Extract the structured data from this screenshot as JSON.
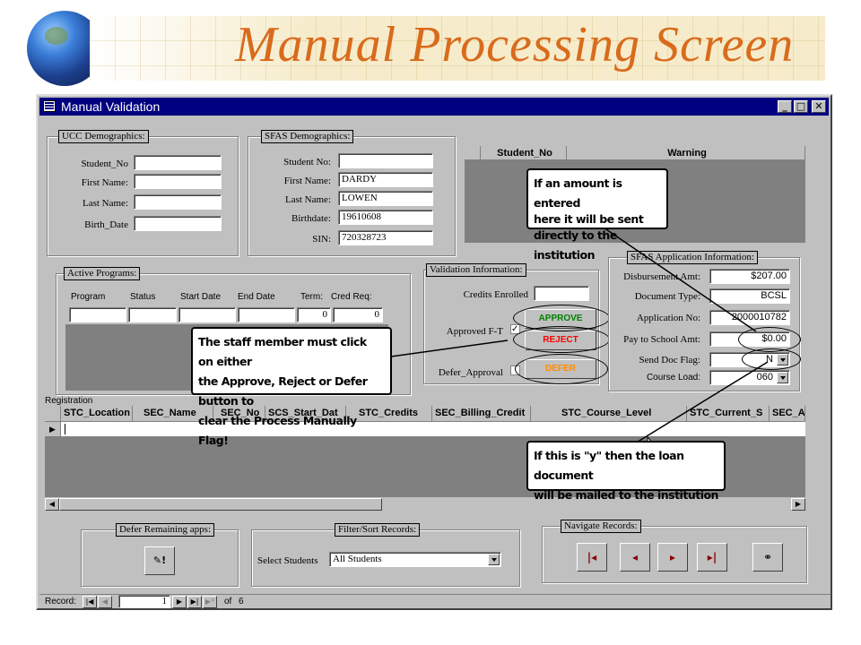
{
  "slide": {
    "title": "Manual Processing Screen"
  },
  "window": {
    "title": "Manual Validation",
    "min": "_",
    "max": "□",
    "close": "✕"
  },
  "ucc": {
    "label": "UCC Demographics:",
    "student_no_label": "Student_No",
    "student_no": "",
    "first_name_label": "First  Name:",
    "first_name": "",
    "last_name_label": "Last  Name:",
    "last_name": "",
    "birth_date_label": "Birth_Date",
    "birth_date": ""
  },
  "sfas": {
    "label": "SFAS Demographics:",
    "student_no_label": "Student  No:",
    "student_no": "",
    "first_name_label": "First  Name:",
    "first_name": "DARDY",
    "last_name_label": "Last  Name:",
    "last_name": "LOWEN",
    "birthdate_label": "Birthdate:",
    "birthdate": "19610608",
    "sin_label": "SIN:",
    "sin": "720328723"
  },
  "warning_grid": {
    "col_student": "Student_No",
    "col_warning": "Warning"
  },
  "active_programs": {
    "label": "Active Programs:",
    "headers": [
      "Program",
      "Status",
      "Start Date",
      "End Date",
      "Term:",
      "Cred Req:"
    ],
    "term": "0",
    "cred_req": "0"
  },
  "validation": {
    "label": "Validation Information:",
    "credits_label": "Credits Enrolled",
    "credits": "",
    "approved_label": "Approved F-T",
    "defer_label": "Defer_Approval",
    "approve_btn": "APPROVE",
    "reject_btn": "REJECT",
    "defer_btn": "DEFER"
  },
  "sfas_app": {
    "label": "SFAS Application Information:",
    "disb_label": "Disbursement Amt:",
    "disb": "$207.00",
    "doc_type_label": "Document Type:",
    "doc_type": "BCSL",
    "app_no_label": "Application No:",
    "app_no": "2000010782",
    "pay_label": "Pay to School Amt:",
    "pay": "$0.00",
    "send_doc_label": "Send Doc Flag:",
    "send_doc": "N",
    "course_load_label": "Course Load:",
    "course_load": "060"
  },
  "registration": {
    "label": "Registration",
    "headers": [
      "STC_Location",
      "SEC_Name",
      "SEC_No",
      "SCS_Start_Dat",
      "STC_Credits",
      "SEC_Billing_Credit",
      "STC_Course_Level",
      "STC_Current_S",
      "SEC_A"
    ]
  },
  "defer_remaining": {
    "label": "Defer Remaining apps:"
  },
  "filter": {
    "label": "Filter/Sort Records:",
    "select_label": "Select Students",
    "select_value": "All Students"
  },
  "navigate": {
    "label": "Navigate Records:"
  },
  "record_nav": {
    "label": "Record:",
    "current": "1",
    "of_label": "of",
    "total": "6"
  },
  "callouts": {
    "amount": [
      "If an amount is entered",
      "here it will be sent",
      "directly to the institution"
    ],
    "staff": [
      "The staff member must click on either",
      "the Approve, Reject or Defer button to",
      "clear the Process Manually Flag!"
    ],
    "flag": [
      "If this is \"y\" then the loan document",
      "will be mailed to the institution"
    ]
  },
  "colors": {
    "title": "#d96b1c",
    "titlebar": "#000080",
    "approve": "#008000",
    "reject": "#ff0000",
    "defer": "#ff8c00",
    "face": "#c0c0c0"
  }
}
